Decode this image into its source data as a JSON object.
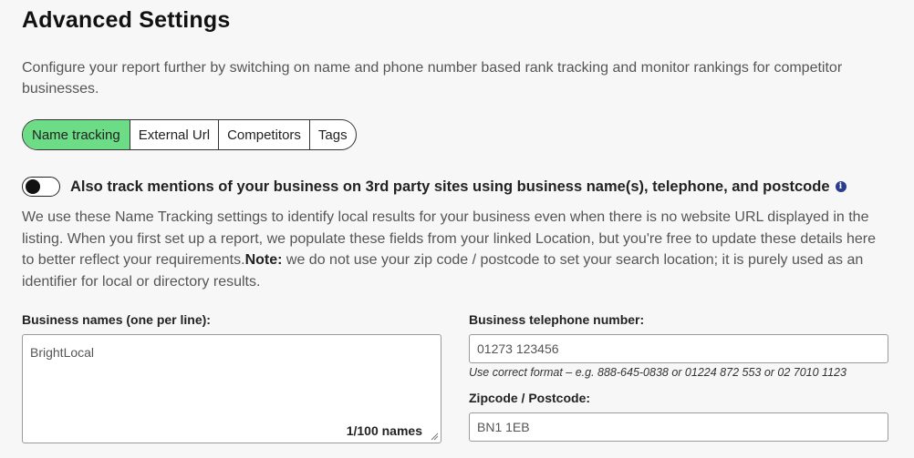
{
  "header": {
    "title": "Advanced Settings",
    "description": "Configure your report further by switching on name and phone number based rank tracking and monitor rankings for competitor businesses."
  },
  "tabs": [
    {
      "label": "Name tracking",
      "active": true
    },
    {
      "label": "External Url",
      "active": false
    },
    {
      "label": "Competitors",
      "active": false
    },
    {
      "label": "Tags",
      "active": false
    }
  ],
  "toggle": {
    "label": "Also track mentions of your business on 3rd party sites using business name(s), telephone, and postcode",
    "enabled": false
  },
  "explanation": {
    "text": "We use these Name Tracking settings to identify local results for your business even when there is no website URL displayed in the listing. When you first set up a report, we populate these fields from your linked Location, but you're free to update these details here to better reflect your requirements.",
    "note_label": "Note:",
    "note_text": " we do not use your zip code / postcode to set your search location; it is purely used as an identifier for local or directory results."
  },
  "business_names": {
    "label": "Business names (one per line):",
    "value": "BrightLocal",
    "counter": "1/100 names"
  },
  "telephone": {
    "label": "Business telephone number:",
    "value": "01273 123456",
    "hint": "Use correct format – e.g. 888-645-0838 or 01224 872 553 or 02 7010 1123"
  },
  "postcode": {
    "label": "Zipcode / Postcode:",
    "value": "BN1 1EB"
  },
  "colors": {
    "active_tab": "#6cdc86",
    "info_icon": "#2b3d8f"
  }
}
